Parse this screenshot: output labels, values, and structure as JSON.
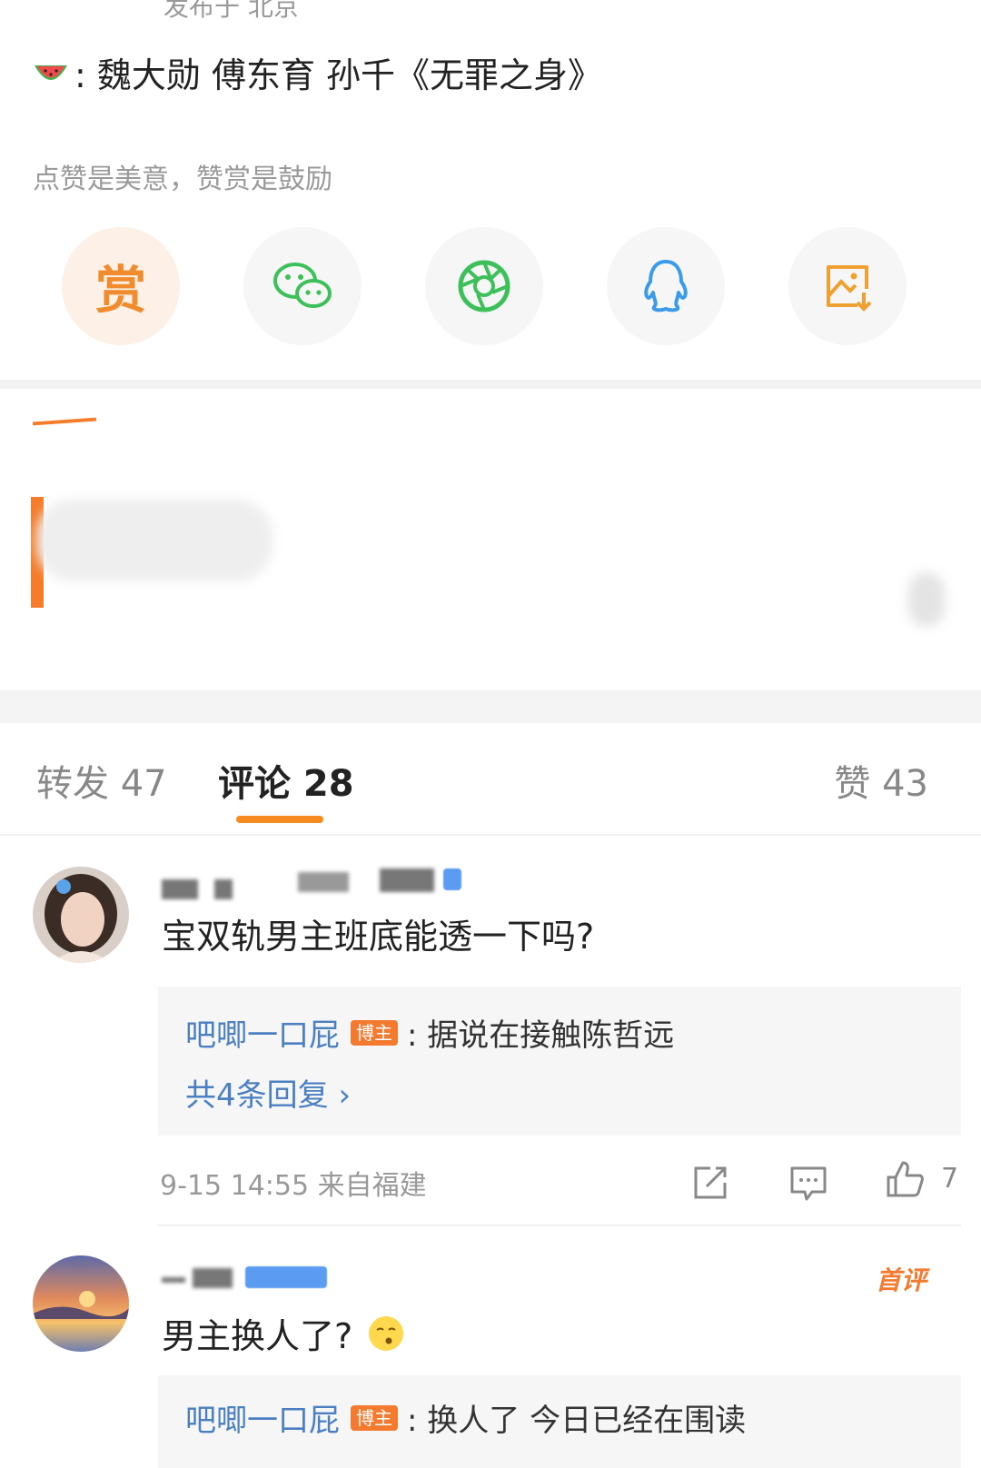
{
  "post": {
    "location": "发布于 北京",
    "text": ":  魏大勋 傅东育 孙千《无罪之身》",
    "reward_hint": "点赞是美意，赞赏是鼓励",
    "reward_label": "赏"
  },
  "share": {
    "items": [
      "reward",
      "wechat-icon",
      "moments-icon",
      "qq-icon",
      "save-image-icon"
    ]
  },
  "tabs": {
    "repost": "转发 47",
    "comment": "评论 28",
    "like": "赞 43"
  },
  "comments": [
    {
      "text": "宝双轨男主班底能透一下吗?",
      "reply": {
        "user": "吧唧一口屁",
        "badge": "博主",
        "text": ": 据说在接触陈哲远",
        "count": "共4条回复  ›"
      },
      "meta": "9-15 14:55 来自福建",
      "likes": "7"
    },
    {
      "text": "男主换人了?",
      "tag": "首评",
      "reply": {
        "user": "吧唧一口屁",
        "badge": "博主",
        "text": ": 换人了 今日已经在围读"
      }
    }
  ],
  "colors": {
    "accent": "#f78b1f",
    "link": "#4a7fc1",
    "wechat": "#3dbf5a",
    "qq": "#3a9bea",
    "save": "#f0a030"
  }
}
